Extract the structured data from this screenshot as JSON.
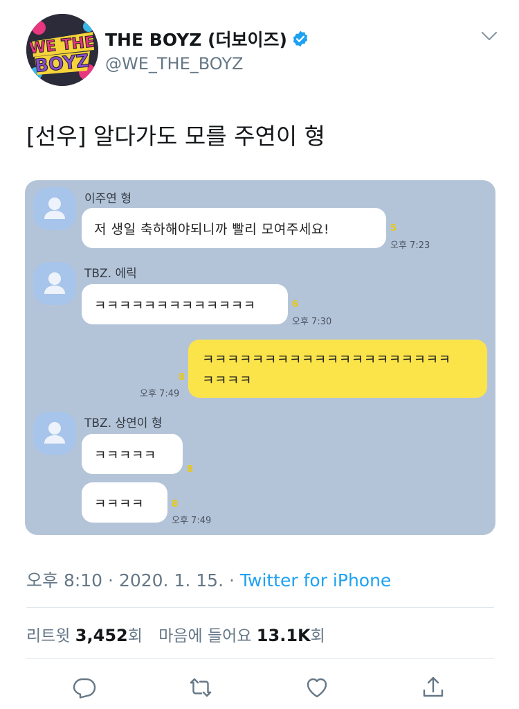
{
  "account": {
    "display_name": "THE BOYZ (더보이즈)",
    "handle": "@WE_THE_BOYZ",
    "avatar_text_line1": "WE THE",
    "avatar_text_line2": "BOYZ"
  },
  "tweet": {
    "text": "[선우] 알다가도 모를 주연이 형"
  },
  "chat": {
    "messages": [
      {
        "sender": "이주연 형",
        "text": "저 생일 축하해야되니까 빨리 모여주세요!",
        "unread": "5",
        "time": "오후 7:23"
      },
      {
        "sender": "TBZ. 에릭",
        "text": "ㅋㅋㅋㅋㅋㅋㅋㅋㅋㅋㅋㅋㅋ",
        "unread": "6",
        "time": "오후 7:30"
      },
      {
        "sender": "",
        "text_line1": "ㅋㅋㅋㅋㅋㅋㅋㅋㅋㅋㅋㅋㅋㅋㅋㅋㅋㅋㅋㅋ",
        "text_line2": "ㅋㅋㅋㅋ",
        "unread": "8",
        "time": "오후 7:49"
      },
      {
        "sender": "TBZ. 상연이 형",
        "text": "ㅋㅋㅋㅋㅋ",
        "unread": "8",
        "time": ""
      },
      {
        "sender": "",
        "text": "ㅋㅋㅋㅋ",
        "unread": "8",
        "time": "오후 7:49"
      }
    ]
  },
  "meta": {
    "time": "오후 8:10",
    "sep1": " · ",
    "date": "2020. 1. 15.",
    "sep2": " · ",
    "source": "Twitter for iPhone"
  },
  "stats": {
    "retweets_label": "리트윗 ",
    "retweets_count": "3,452",
    "retweets_suffix": "회",
    "likes_label": "마음에 들어요 ",
    "likes_count": "13.1K",
    "likes_suffix": "회"
  },
  "actions": {
    "reply_icon": "reply-icon",
    "retweet_icon": "retweet-icon",
    "like_icon": "heart-icon",
    "share_icon": "share-icon"
  },
  "colors": {
    "link": "#1da1f2",
    "secondary_text": "#657786",
    "chat_background": "#b4c4d8",
    "outgoing_bubble": "#fbe44a",
    "unread_count": "#e9c80c",
    "verified": "#1da1f2"
  }
}
